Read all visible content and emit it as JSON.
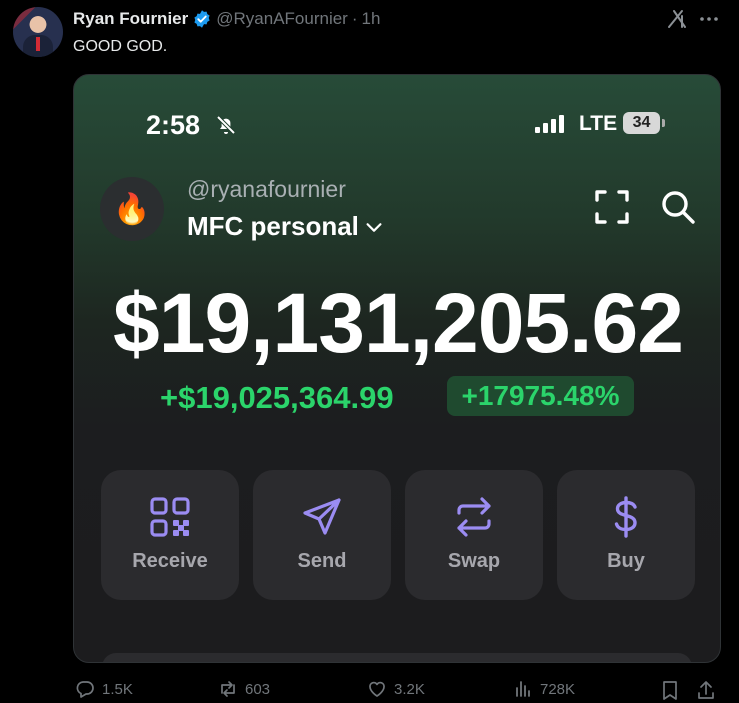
{
  "tweet": {
    "author_name": "Ryan Fournier",
    "author_handle": "@RyanAFournier",
    "separator": "·",
    "time": "1h",
    "text": "GOOD GOD."
  },
  "phone": {
    "status_time": "2:58",
    "network": "LTE",
    "battery": "34",
    "wallet_avatar_emoji": "🔥",
    "username": "@ryanafournier",
    "wallet_name": "MFC personal",
    "balance": "$19,131,205.62",
    "change_amount": "+$19,025,364.99",
    "change_percent": "+17975.48%",
    "actions": [
      {
        "label": "Receive",
        "icon": "qr-code-icon"
      },
      {
        "label": "Send",
        "icon": "send-icon"
      },
      {
        "label": "Swap",
        "icon": "swap-icon"
      },
      {
        "label": "Buy",
        "icon": "dollar-icon"
      }
    ]
  },
  "engagement": {
    "replies": "1.5K",
    "reposts": "603",
    "likes": "3.2K",
    "views": "728K"
  },
  "colors": {
    "accent_purple": "#9b8cf2",
    "gain_green": "#2bd46b",
    "verified_blue": "#1d9bf0"
  }
}
